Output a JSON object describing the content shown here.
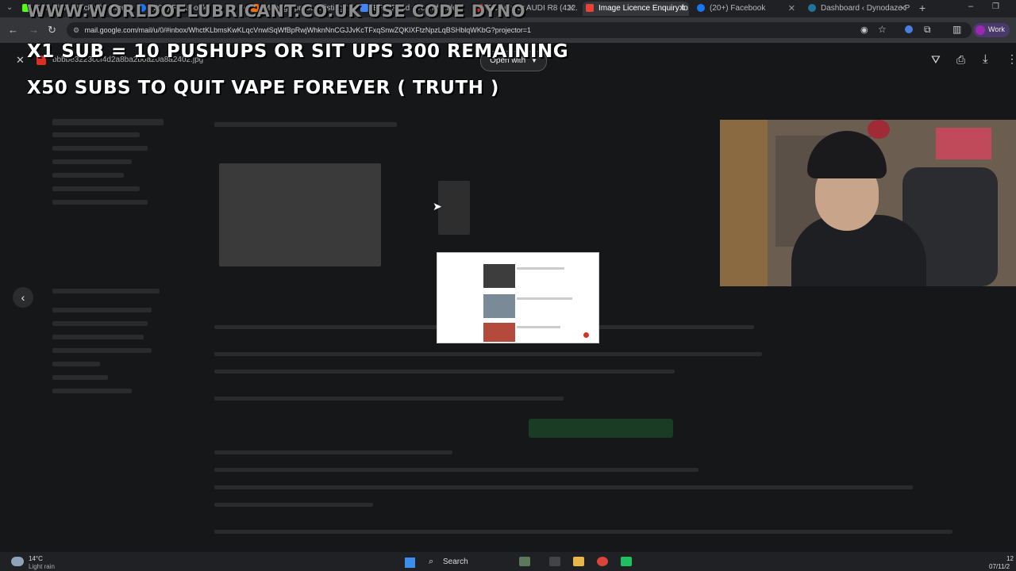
{
  "browser": {
    "tabs": [
      {
        "label": "Kick Clips - Kick Chatsters",
        "icon": "kick-icon"
      },
      {
        "label": "(20+) Facebook",
        "icon": "facebook-icon"
      },
      {
        "label": "Manage product listings",
        "icon": "store-icon"
      },
      {
        "label": "EPC Food Ground Rules",
        "icon": "doc-icon"
      },
      {
        "label": "Octane for AUDI R8 (422...",
        "icon": "octane-icon"
      },
      {
        "label": "Image Licence Enquiry fo",
        "icon": "gmail-icon",
        "active": true
      },
      {
        "label": "(20+) Facebook",
        "icon": "facebook-icon"
      },
      {
        "label": "Dashboard ‹ Dynodaze P",
        "icon": "wordpress-icon"
      }
    ],
    "url": "mail.google.com/mail/u/0/#inbox/WhctKLbmsKwKLqcVnwlSqWfBpRwjWhknNnCGJJvKcTFxqSnwZQKlXFtzNpzLqBSHblqWKbG?projector=1",
    "profile_label": "Work"
  },
  "overlay_text": {
    "line0": "WWW.WORLDOFLUBRICANT.CO.UK USE CODE DYNO",
    "line1": "X1 SUB = 10 PUSHUPS OR SIT UPS 300 REMAINING",
    "line2": "X50 SUBS TO QUIT VAPE FOREVER ( TRUTH )"
  },
  "viewer": {
    "filename": "bbbbe3223ccf4d2a8ba2b0a20a8a2402.jpg",
    "open_with_label": "Open with"
  },
  "taskbar": {
    "weather_temp": "14°C",
    "weather_desc": "Light rain",
    "search_placeholder": "Search",
    "time": "12",
    "date": "07/11/2"
  },
  "colors": {
    "tab_strip": "#202124",
    "toolbar": "#35363a",
    "overlay_dim": "#161718",
    "text_overlay": "#ffffff",
    "accent_green": "#1a4d2a"
  }
}
